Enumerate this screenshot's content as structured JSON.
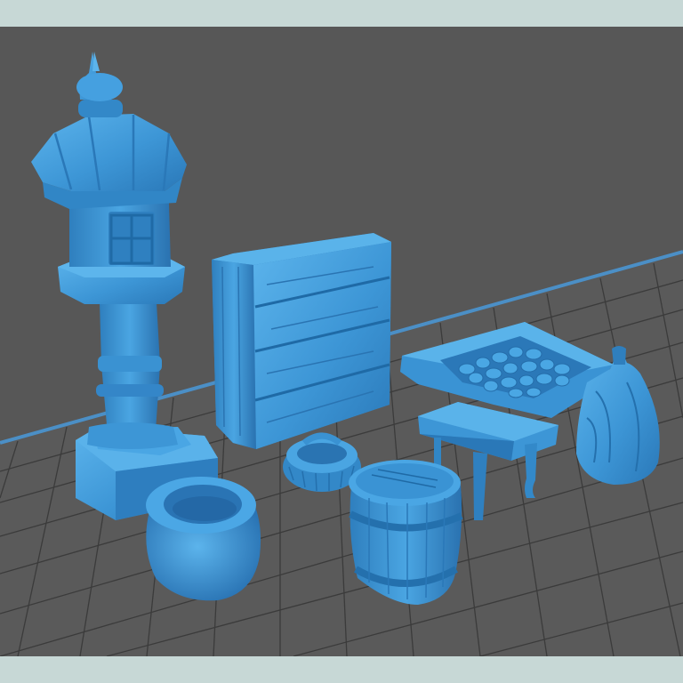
{
  "scene": {
    "background_color": "#575757",
    "frame_color": "#c7d8d6",
    "model_color": "#3d96d6",
    "grid_line_color": "#3b3b3b",
    "build_plate_edge_color": "#4b8fc6"
  },
  "objects": [
    {
      "name": "stone-lantern"
    },
    {
      "name": "chest-of-drawers"
    },
    {
      "name": "tray-of-stones"
    },
    {
      "name": "small-table"
    },
    {
      "name": "grain-sack"
    },
    {
      "name": "wicker-basket"
    },
    {
      "name": "wooden-barrel"
    },
    {
      "name": "clay-pot"
    }
  ]
}
